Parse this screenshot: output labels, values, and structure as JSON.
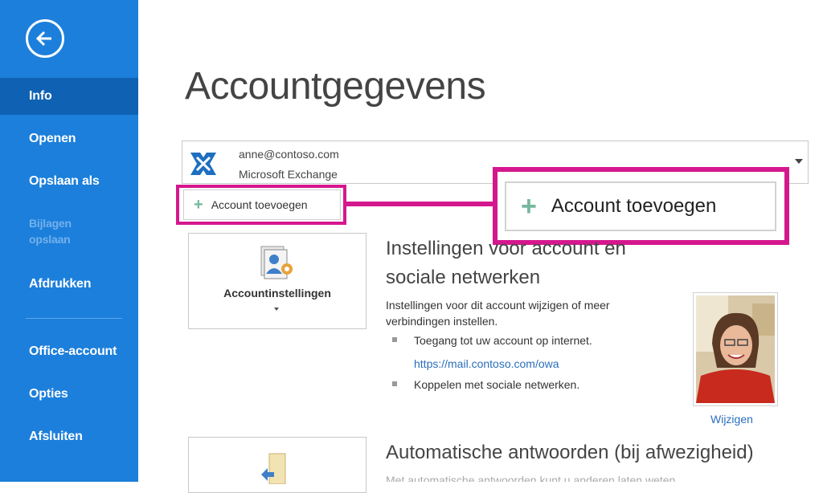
{
  "sidebar": {
    "back_label": "Back",
    "items": [
      {
        "label": "Info",
        "active": true
      },
      {
        "label": "Openen"
      },
      {
        "label": "Opslaan als"
      },
      {
        "label": "Bijlagen opslaan",
        "disabled": true
      },
      {
        "label": "Afdrukken"
      },
      {
        "label": "Office-account"
      },
      {
        "label": "Opties"
      },
      {
        "label": "Afsluiten"
      }
    ]
  },
  "page": {
    "title": "Accountgegevens"
  },
  "account": {
    "email": "anne@contoso.com",
    "type": "Microsoft Exchange"
  },
  "add_account": {
    "label": "Account toevoegen",
    "icon": "plus-icon"
  },
  "settings_tile": {
    "label": "Accountinstellingen",
    "icon": "account-settings-icon"
  },
  "settings_section": {
    "heading": "Instellingen voor account en sociale netwerken",
    "description": "Instellingen voor dit account wijzigen of meer verbindingen instellen.",
    "bullet1": "Toegang tot uw account op internet.",
    "link": "https://mail.contoso.com/owa",
    "bullet2": "Koppelen met sociale netwerken."
  },
  "profile": {
    "change_label": "Wijzigen"
  },
  "auto_reply": {
    "heading": "Automatische antwoorden (bij afwezigheid)",
    "description": "Met automatische antwoorden kunt u anderen laten weten"
  },
  "colors": {
    "sidebar": "#1c7fdb",
    "active": "#0f62b3",
    "highlight": "#d5178e",
    "plus": "#74b89c"
  }
}
